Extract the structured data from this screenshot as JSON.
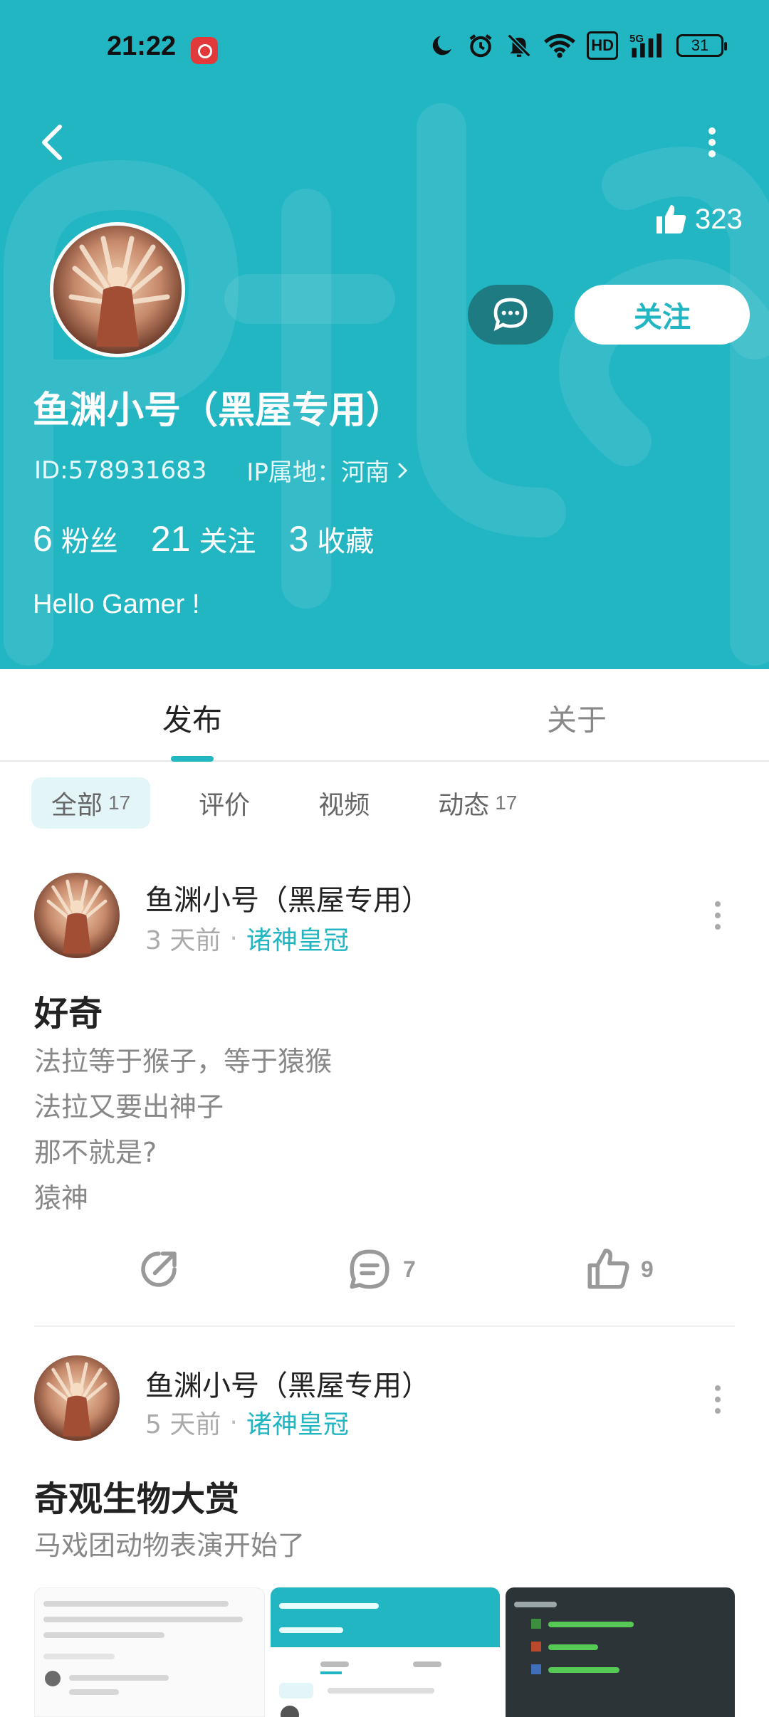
{
  "status_bar": {
    "time": "21:22",
    "app_icon": "netease-music-icon",
    "icons": [
      "moon-icon",
      "alarm-icon",
      "mute-icon",
      "wifi-icon"
    ],
    "hd": "HD",
    "network": "5G",
    "battery": "31"
  },
  "colors": {
    "accent": "#22b6c3",
    "header_bg": "#22b6c3",
    "message_button_bg": "#1e7b82",
    "muted_text": "#888888"
  },
  "profile": {
    "likes_count": "323",
    "username": "鱼渊小号（黑屋专用）",
    "id_text": "ID:578931683",
    "ip_text": "IP属地：河南",
    "follow_label": "关注",
    "stats": [
      {
        "num": "6",
        "label": "粉丝"
      },
      {
        "num": "21",
        "label": "关注"
      },
      {
        "num": "3",
        "label": "收藏"
      }
    ],
    "bio": "Hello Gamer !"
  },
  "tabs": [
    {
      "label": "发布",
      "active": true
    },
    {
      "label": "关于",
      "active": false
    }
  ],
  "filters": [
    {
      "label": "全部",
      "count": "17",
      "active": true
    },
    {
      "label": "评价",
      "count": "",
      "active": false
    },
    {
      "label": "视频",
      "count": "",
      "active": false
    },
    {
      "label": "动态",
      "count": "17",
      "active": false
    }
  ],
  "posts": [
    {
      "user": "鱼渊小号（黑屋专用）",
      "time": "3 天前",
      "game": "诸神皇冠",
      "title": "好奇",
      "lines": [
        "法拉等于猴子，等于猿猴",
        "法拉又要出神子",
        "那不就是?",
        "猿神"
      ],
      "comments": "7",
      "likes": "9"
    },
    {
      "user": "鱼渊小号（黑屋专用）",
      "time": "5 天前",
      "game": "诸神皇冠",
      "title": "奇观生物大赏",
      "lines": [
        "马戏团动物表演开始了"
      ]
    }
  ]
}
